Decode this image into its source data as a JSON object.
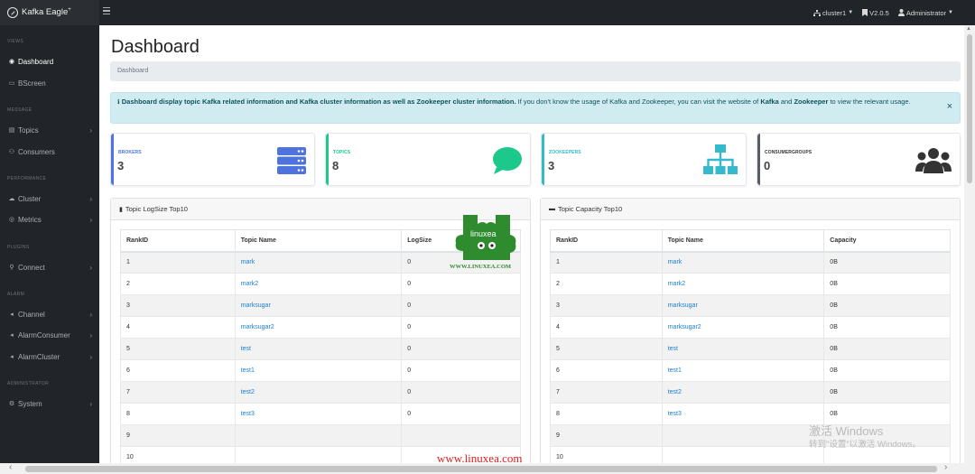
{
  "app": {
    "title": "Kafka Eagle",
    "title_sup": "+"
  },
  "topnav": {
    "cluster": "cluster1",
    "version": "V2.0.5",
    "user": "Administrator"
  },
  "sidebar": {
    "sections": {
      "views": "VIEWS",
      "message": "MESSAGE",
      "performance": "PERFORMANCE",
      "plugins": "PLUGINS",
      "alarm": "ALARM",
      "administrator": "ADMINISTRATOR"
    },
    "items": {
      "dashboard": "Dashboard",
      "bscreen": "BScreen",
      "topics": "Topics",
      "consumers": "Consumers",
      "cluster": "Cluster",
      "metrics": "Metrics",
      "connect": "Connect",
      "channel": "Channel",
      "alarm_consumer": "AlarmConsumer",
      "alarm_cluster": "AlarmCluster",
      "system": "System"
    }
  },
  "page": {
    "title": "Dashboard",
    "breadcrumb": "Dashboard",
    "alert": {
      "bold1": "Dashboard display topic Kafka related information and Kafka cluster information as well as Zookeeper cluster information.",
      "text1": " If you don't know the usage of Kafka and Zookeeper, you can visit the website of ",
      "bold2": "Kafka",
      "text2": " and ",
      "bold3": "Zookeeper",
      "text3": " to view the relevant usage.",
      "close": "×"
    }
  },
  "cards": {
    "brokers": {
      "label": "BROKERS",
      "value": "3"
    },
    "topics": {
      "label": "TOPICS",
      "value": "8"
    },
    "zookeepers": {
      "label": "ZOOKEEPERS",
      "value": "3"
    },
    "consumer_groups": {
      "label": "CONSUMERGROUPS",
      "value": "0"
    }
  },
  "logsize_panel": {
    "title": "Topic LogSize Top10",
    "headers": [
      "RankID",
      "Topic Name",
      "LogSize"
    ],
    "rows": [
      [
        "1",
        "mark",
        "0"
      ],
      [
        "2",
        "mark2",
        "0"
      ],
      [
        "3",
        "marksugar",
        "0"
      ],
      [
        "4",
        "marksugar2",
        "0"
      ],
      [
        "5",
        "test",
        "0"
      ],
      [
        "6",
        "test1",
        "0"
      ],
      [
        "7",
        "test2",
        "0"
      ],
      [
        "8",
        "test3",
        "0"
      ],
      [
        "9",
        "",
        ""
      ],
      [
        "10",
        "",
        ""
      ]
    ]
  },
  "capacity_panel": {
    "title": "Topic Capacity Top10",
    "headers": [
      "RankID",
      "Topic Name",
      "Capacity"
    ],
    "rows": [
      [
        "1",
        "mark",
        "0B"
      ],
      [
        "2",
        "mark2",
        "0B"
      ],
      [
        "3",
        "marksugar",
        "0B"
      ],
      [
        "4",
        "marksugar2",
        "0B"
      ],
      [
        "5",
        "test",
        "0B"
      ],
      [
        "6",
        "test1",
        "0B"
      ],
      [
        "7",
        "test2",
        "0B"
      ],
      [
        "8",
        "test3",
        "0B"
      ],
      [
        "9",
        "",
        ""
      ],
      [
        "10",
        "",
        ""
      ]
    ]
  },
  "watermark": {
    "logo_text": "linuxea",
    "logo_url": "WWW.LINUXEA.COM",
    "footer": "www.linuxea.com"
  },
  "os_overlay": {
    "line1": "激活 Windows",
    "line2": "转到\"设置\"以激活 Windows。"
  },
  "colors": {
    "brokers": "#4e73df",
    "topics": "#1cc88a",
    "zookeepers": "#36b9cc",
    "consumer_groups": "#5a5c69",
    "link": "#1a7fd4"
  }
}
